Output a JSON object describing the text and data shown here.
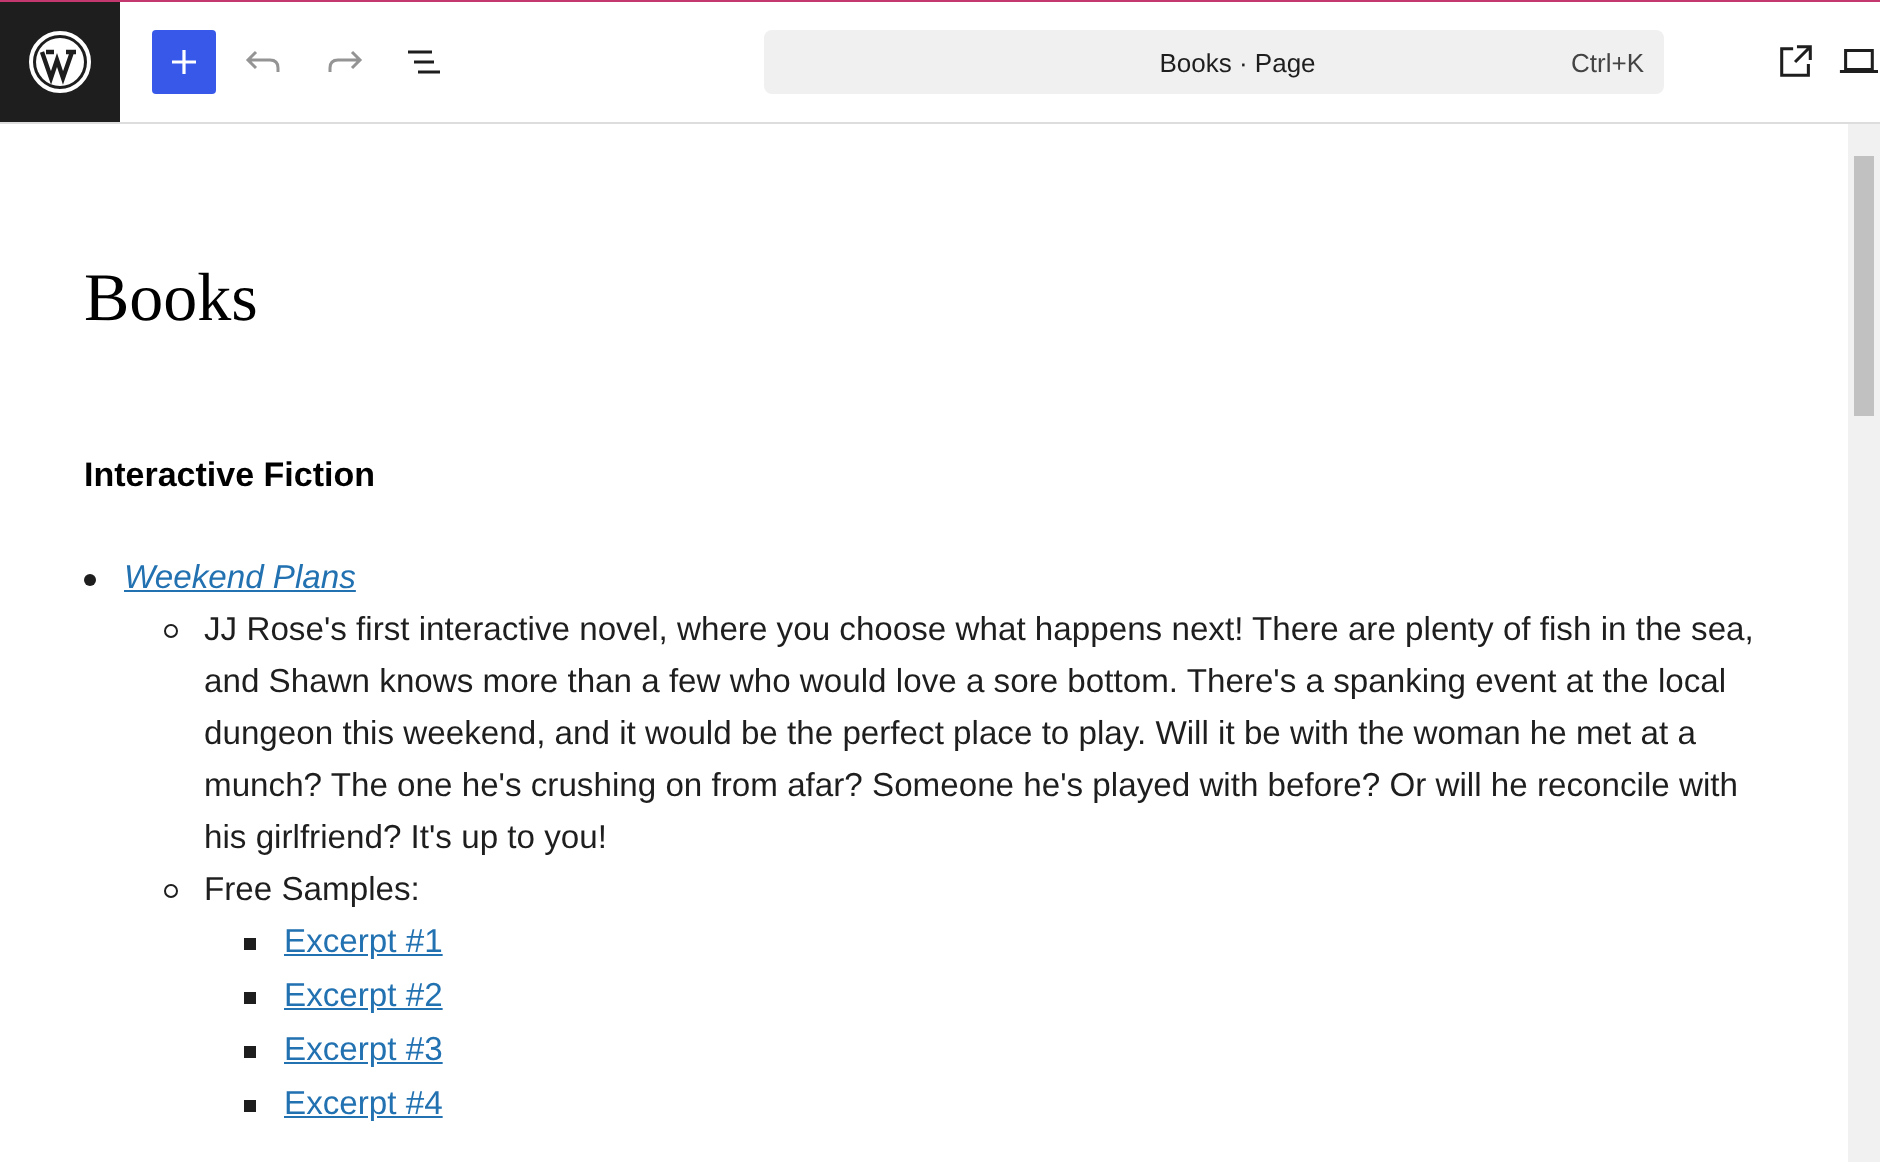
{
  "toolbar": {
    "undo": {
      "disabled": true
    },
    "redo": {
      "disabled": true
    }
  },
  "command_bar": {
    "title": "Books · Page",
    "shortcut": "Ctrl+K"
  },
  "page": {
    "title": "Books",
    "heading": "Interactive Fiction",
    "list": [
      {
        "text": "Weekend Plans",
        "kind": "italic-link",
        "children": [
          {
            "text": "JJ Rose's first interactive novel, where you choose what happens next! There are plenty of fish in the sea, and Shawn knows more than a few who would love a sore bottom. There's a spanking event at the local dungeon this weekend, and it would be the perfect place to play. Will it be with the woman he met at a munch? The one he's crushing on from afar? Someone he's played with before? Or will he reconcile with his girlfriend? It's up to you!",
            "kind": "text"
          },
          {
            "text": "Free Samples:",
            "kind": "text",
            "children": [
              {
                "text": "Excerpt #1",
                "kind": "link"
              },
              {
                "text": "Excerpt #2",
                "kind": "link"
              },
              {
                "text": "Excerpt #3",
                "kind": "link"
              },
              {
                "text": "Excerpt #4",
                "kind": "link"
              }
            ]
          }
        ]
      }
    ]
  }
}
